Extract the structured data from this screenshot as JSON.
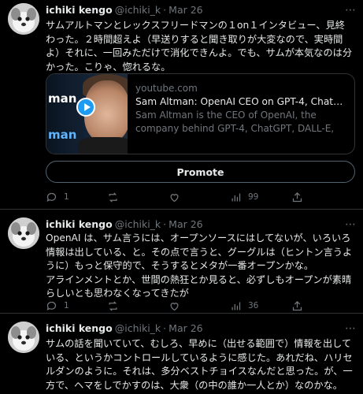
{
  "tweets": [
    {
      "author": {
        "name": "ichiki kengo",
        "handle": "@ichiki_k",
        "time": "Mar 26"
      },
      "text": "サムアルトマンとレックスフリードマンの１on１インタビュー、見終わった。２時間超えよ（早送りすると聞き取りが大変なので、実時間よ）それに、一回みただけで消化できんよ。でも、サムが本気なのは分かった。こりゃ、惚れるな。",
      "card": {
        "thumb_text_top": "man",
        "thumb_text_bottom": "man",
        "domain": "youtube.com",
        "title": "Sam Altman: OpenAI CEO on GPT-4, ChatGPT, a...",
        "description": "Sam Altman is the CEO of OpenAI, the company behind GPT-4, ChatGPT, DALL-E, Codex, and ma..."
      },
      "promote_label": "Promote",
      "actions": {
        "replies": "1",
        "retweets": "",
        "likes": "",
        "views": "99"
      }
    },
    {
      "author": {
        "name": "ichiki kengo",
        "handle": "@ichiki_k",
        "time": "Mar 26"
      },
      "text": "OpenAI は、サム言うには、オープンソースにはしてないが、いろいろ情報は出している、と。その点で言うと、グーグルは（ヒントン言うように）もっと保守的で、そうするとメタが一番オープンかな。\nアラインメントとか、世間の熱狂とか見ると、必ずしもオープンが素晴らしいとも思わなくなってきたが",
      "actions": {
        "replies": "1",
        "retweets": "",
        "likes": "",
        "views": "36"
      }
    },
    {
      "author": {
        "name": "ichiki kengo",
        "handle": "@ichiki_k",
        "time": "Mar 26"
      },
      "text": "サムの話を聞いていて、むしろ、早めに（出せる範囲で）情報を出している、というかコントロールしているように感じた。あれだね、ハリセルダンのように。それは、多分ベストチョイスなんだと思った。が、一方で、ヘマをしでかすのは、大衆（の中の誰か一人とか）なのかな。"
    }
  ],
  "colors": {
    "background": "#000000",
    "text": "#e7e9ea",
    "secondary": "#71767b",
    "border": "#2f3336",
    "accent": "#1d9bf0"
  },
  "icons": [
    "reply-icon",
    "retweet-icon",
    "like-icon",
    "views-icon",
    "share-icon",
    "more-icon",
    "play-icon"
  ]
}
